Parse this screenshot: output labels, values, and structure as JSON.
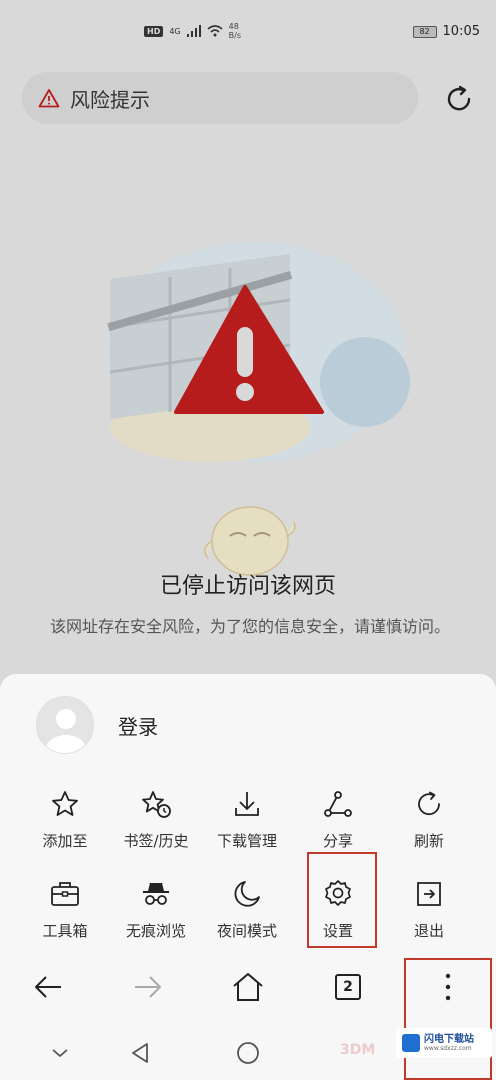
{
  "status_bar": {
    "hd": "HD",
    "network": "4G",
    "speed_value": "48",
    "speed_unit": "B/s",
    "battery": "82",
    "time": "10:05"
  },
  "address": {
    "title": "风险提示"
  },
  "warning": {
    "title": "已停止访问该网页",
    "description": "该网址存在安全风险，为了您的信息安全，请谨慎访问。"
  },
  "sheet": {
    "login_label": "登录",
    "menu_row1": [
      {
        "label": "添加至",
        "icon": "star-icon"
      },
      {
        "label": "书签/历史",
        "icon": "bookmark-history-icon"
      },
      {
        "label": "下载管理",
        "icon": "download-icon"
      },
      {
        "label": "分享",
        "icon": "share-icon"
      },
      {
        "label": "刷新",
        "icon": "refresh-icon"
      }
    ],
    "menu_row2": [
      {
        "label": "工具箱",
        "icon": "toolbox-icon"
      },
      {
        "label": "无痕浏览",
        "icon": "incognito-icon"
      },
      {
        "label": "夜间模式",
        "icon": "moon-icon"
      },
      {
        "label": "设置",
        "icon": "gear-icon"
      },
      {
        "label": "退出",
        "icon": "exit-icon"
      }
    ]
  },
  "bottom_nav": {
    "tab_count": "2"
  },
  "watermark": {
    "site_name": "闪电下载站",
    "site_url": "www.sdxzz.com",
    "brand_3d": "3DM"
  },
  "colors": {
    "warning_red": "#b71c1c",
    "highlight_red": "#c0392b",
    "overlay_gray": "#d9d9d9",
    "sheet_bg": "#f7f7f7"
  }
}
